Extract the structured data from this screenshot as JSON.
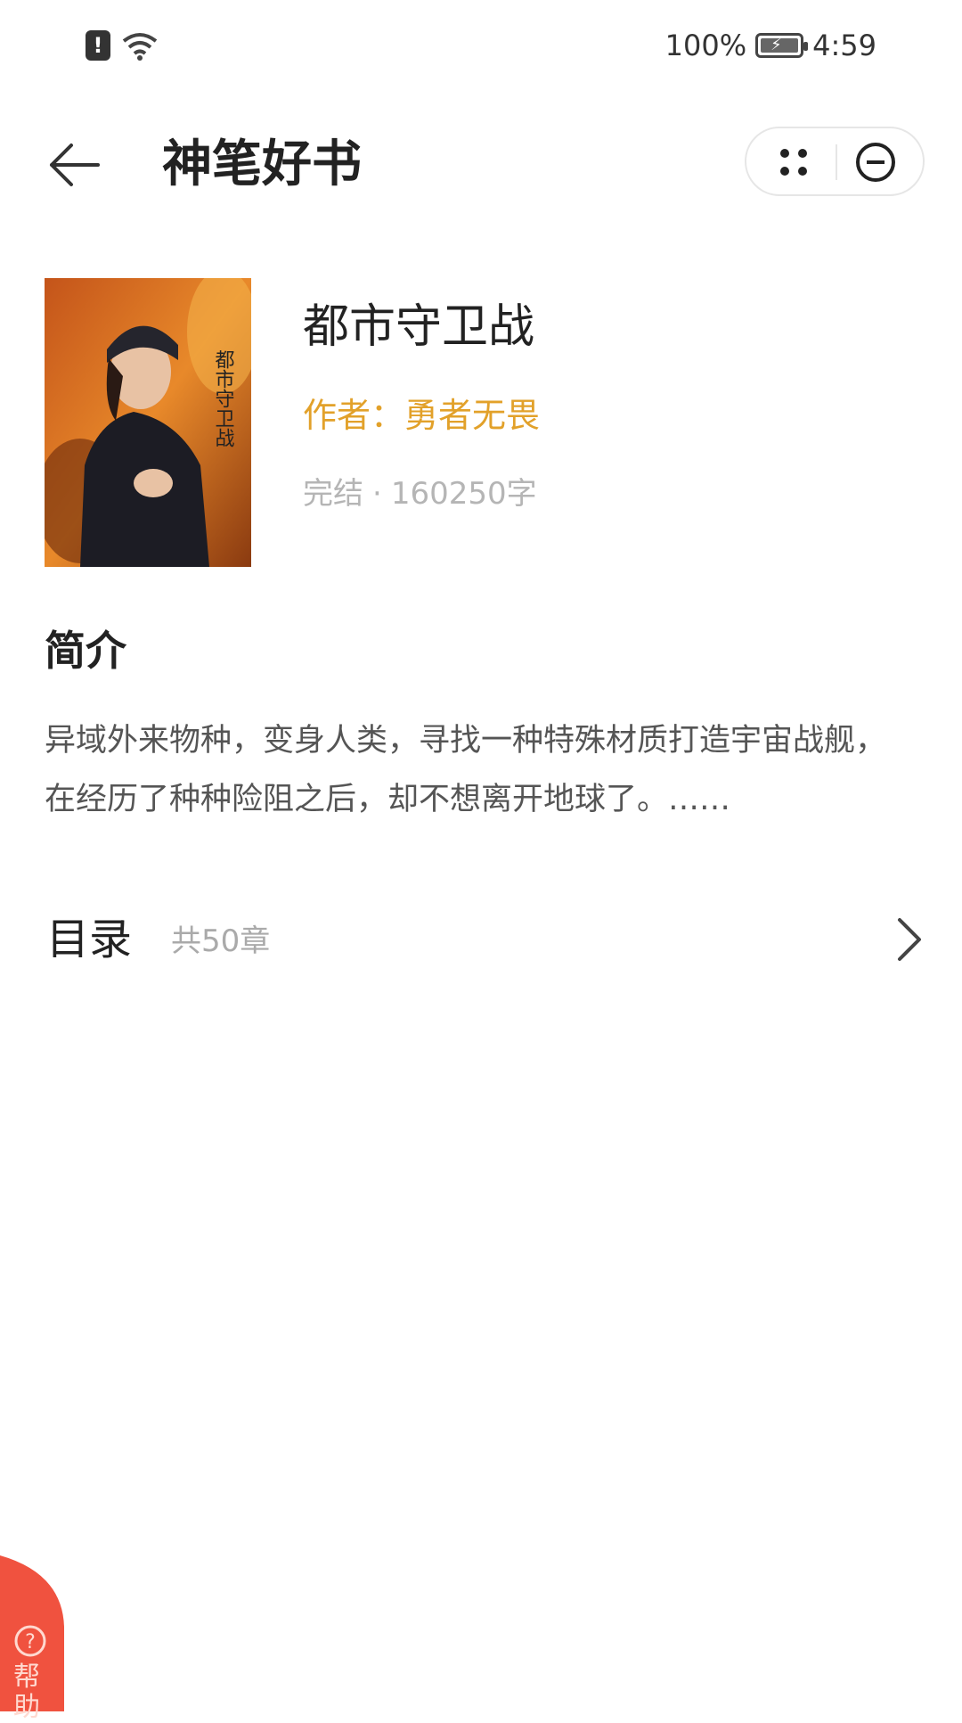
{
  "status_bar": {
    "battery": "100%",
    "time": "4:59"
  },
  "title_bar": {
    "title": "神笔好书"
  },
  "book": {
    "title": "都市守卫战",
    "author": "作者：勇者无畏",
    "status": "完结",
    "separator": "·",
    "word_count": "160250字",
    "cover_text": "都市守卫战"
  },
  "intro": {
    "heading": "简介",
    "text": "异域外来物种，变身人类，寻找一种特殊材质打造宇宙战舰，在经历了种种险阻之后，却不想离开地球了。……"
  },
  "catalog": {
    "label": "目录",
    "count": "共50章"
  },
  "help": {
    "label": "帮助"
  },
  "colors": {
    "accent": "#e2a12a",
    "help_red": "#f0523f"
  },
  "icons": [
    "sim-alert-icon",
    "wifi-icon",
    "battery-icon",
    "back-arrow-icon",
    "more-dots-icon",
    "close-circle-icon",
    "chevron-right-icon",
    "help-question-icon"
  ]
}
